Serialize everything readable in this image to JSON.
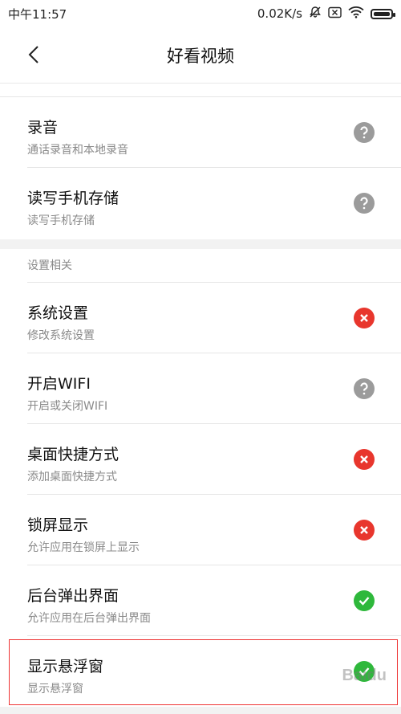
{
  "status_bar": {
    "time": "中午11:57",
    "speed": "0.02K/s"
  },
  "header": {
    "title": "好看视频",
    "back_icon": "chevron-left-icon"
  },
  "permissions_top": [
    {
      "title": "录音",
      "desc": "通话录音和本地录音",
      "state": "ask"
    },
    {
      "title": "读写手机存储",
      "desc": "读写手机存储",
      "state": "ask"
    }
  ],
  "settings_section": {
    "label": "设置相关",
    "items": [
      {
        "title": "系统设置",
        "desc": "修改系统设置",
        "state": "deny"
      },
      {
        "title": "开启WIFI",
        "desc": "开启或关闭WIFI",
        "state": "ask"
      },
      {
        "title": "桌面快捷方式",
        "desc": "添加桌面快捷方式",
        "state": "deny"
      },
      {
        "title": "锁屏显示",
        "desc": "允许应用在锁屏上显示",
        "state": "deny"
      },
      {
        "title": "后台弹出界面",
        "desc": "允许应用在后台弹出界面",
        "state": "allow"
      },
      {
        "title": "显示悬浮窗",
        "desc": "显示悬浮窗",
        "state": "allow"
      }
    ]
  },
  "colors": {
    "ask": "#9b9b9b",
    "deny": "#e8362d",
    "allow": "#2eb83b",
    "highlight": "#e33333"
  },
  "watermark": "Baidu"
}
